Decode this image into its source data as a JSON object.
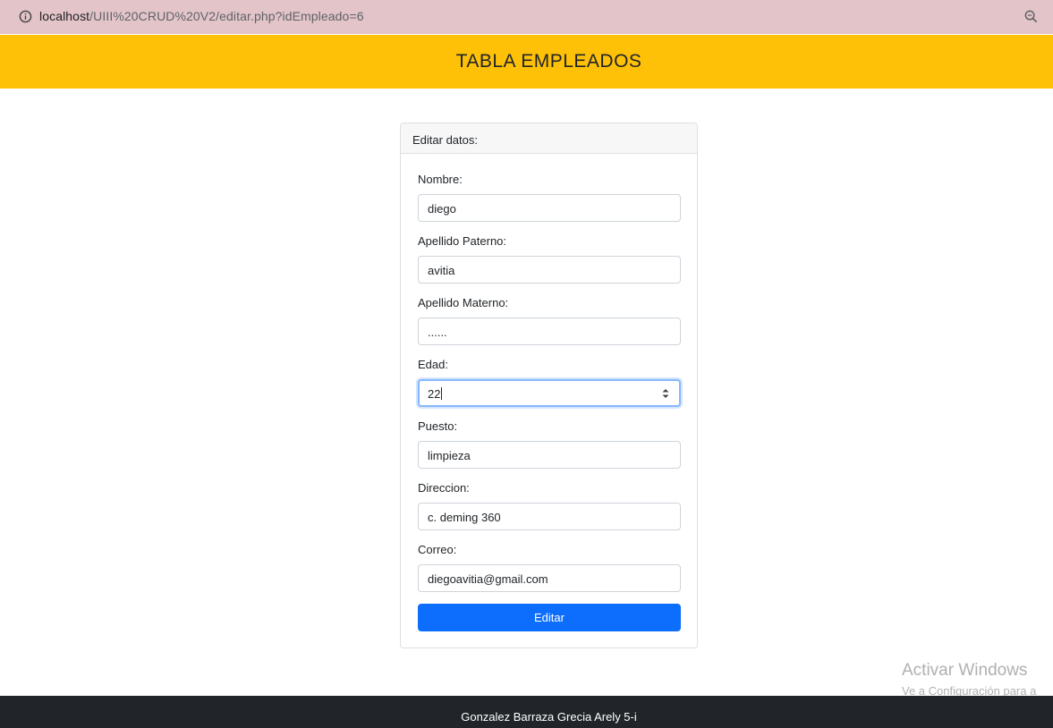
{
  "browser": {
    "url_host": "localhost",
    "url_path": "/UIII%20CRUD%20V2/editar.php?idEmpleado=6",
    "icons": [
      "info-icon",
      "zoom-icon"
    ]
  },
  "header": {
    "title": "TABLA EMPLEADOS"
  },
  "card": {
    "title": "Editar datos:",
    "fields": [
      {
        "label": "Nombre:",
        "value": "diego"
      },
      {
        "label": "Apellido Paterno:",
        "value": "avitia"
      },
      {
        "label": "Apellido Materno:",
        "value": "......"
      },
      {
        "label": "Edad:",
        "value": "22"
      },
      {
        "label": "Puesto:",
        "value": "limpieza"
      },
      {
        "label": "Direccion:",
        "value": "c. deming 360"
      },
      {
        "label": "Correo:",
        "value": "diegoavitia@gmail.com"
      }
    ],
    "submit_label": "Editar"
  },
  "watermark": {
    "line1": "Activar Windows",
    "line2": "Ve a Configuración para a"
  },
  "footer": {
    "text": "Gonzalez Barraza Grecia Arely 5-i"
  },
  "colors": {
    "header": "#ffc107",
    "primary": "#0d6efd",
    "footer": "#212529",
    "address_bar": "#e3c4c8"
  }
}
